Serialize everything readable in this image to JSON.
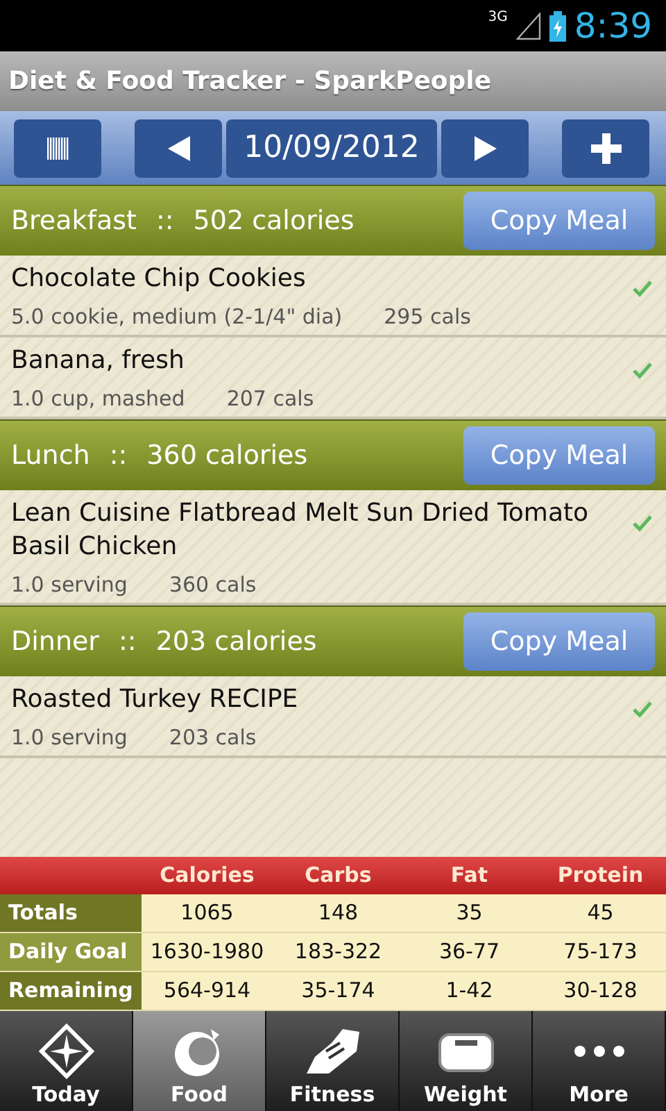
{
  "status_bar": {
    "network": "3G",
    "time": "8:39"
  },
  "title": "Diet & Food Tracker - SparkPeople",
  "toolbar": {
    "date": "10/09/2012"
  },
  "meals": [
    {
      "name": "Breakfast",
      "separator": "::",
      "calories": "502 calories",
      "button": "Copy Meal",
      "items": [
        {
          "name": "Chocolate Chip Cookies",
          "serving": "5.0 cookie, medium (2-1/4\" dia)",
          "cals": "295 cals",
          "checked": true
        },
        {
          "name": "Banana, fresh",
          "serving": "1.0 cup, mashed",
          "cals": "207 cals",
          "checked": true
        }
      ]
    },
    {
      "name": "Lunch",
      "separator": "::",
      "calories": "360 calories",
      "button": "Copy Meal",
      "items": [
        {
          "name": "Lean Cuisine Flatbread Melt Sun Dried Tomato Basil Chicken",
          "serving": "1.0 serving",
          "cals": "360 cals",
          "checked": true
        }
      ]
    },
    {
      "name": "Dinner",
      "separator": "::",
      "calories": "203 calories",
      "button": "Copy Meal",
      "items": [
        {
          "name": "Roasted Turkey RECIPE",
          "serving": "1.0 serving",
          "cals": "203 cals",
          "checked": true
        }
      ]
    }
  ],
  "summary": {
    "columns": [
      "Calories",
      "Carbs",
      "Fat",
      "Protein"
    ],
    "rows": [
      {
        "label": "Totals",
        "values": [
          "1065",
          "148",
          "35",
          "45"
        ]
      },
      {
        "label": "Daily Goal",
        "values": [
          "1630-1980",
          "183-322",
          "36-77",
          "75-173"
        ]
      },
      {
        "label": "Remaining",
        "values": [
          "564-914",
          "35-174",
          "1-42",
          "30-128"
        ]
      }
    ]
  },
  "tabs": [
    {
      "label": "Today",
      "kind": "today",
      "selected": false
    },
    {
      "label": "Food",
      "kind": "food",
      "selected": true
    },
    {
      "label": "Fitness",
      "kind": "fitness",
      "selected": false
    },
    {
      "label": "Weight",
      "kind": "weight",
      "selected": false
    },
    {
      "label": "More",
      "kind": "more",
      "selected": false
    }
  ]
}
